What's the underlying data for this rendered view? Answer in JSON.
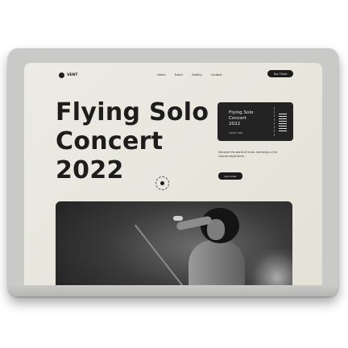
{
  "nav": {
    "logo_text": "VENT",
    "links": [
      "Home",
      "Event",
      "Gallery",
      "Contact"
    ],
    "cta_label": "Buy Ticket"
  },
  "hero": {
    "title_lines": [
      "Flying Solo",
      "Concert",
      "2022"
    ]
  },
  "ticket": {
    "lines": [
      "Flying Solo",
      "Concert",
      "2022"
    ],
    "subtext": "ADMIT ONE"
  },
  "side": {
    "description": "Discover the world of music and enjoy a live concert experience.",
    "button_label": "Get Ticket"
  },
  "colors": {
    "background": "#e8e6dd",
    "dark": "#1d1d1d",
    "frame": "#c9c9c7"
  },
  "icons": {
    "logo": "logo-icon",
    "disc": "vinyl-record-icon",
    "barcode": "barcode-icon"
  }
}
